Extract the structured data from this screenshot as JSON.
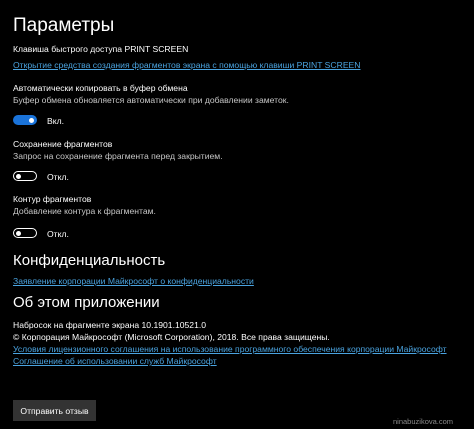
{
  "page_title": "Параметры",
  "hotkey": {
    "title": "Клавиша быстрого доступа PRINT SCREEN",
    "link": "Открытие средства создания фрагментов экрана с помощью клавиши PRINT SCREEN"
  },
  "auto_copy": {
    "title": "Автоматически копировать в буфер обмена",
    "description": "Буфер обмена обновляется автоматически при добавлении заметок.",
    "state": "Вкл.",
    "on": true
  },
  "save_snips": {
    "title": "Сохранение фрагментов",
    "description": "Запрос на сохранение фрагмента перед закрытием.",
    "state": "Откл.",
    "on": false
  },
  "outline": {
    "title": "Контур фрагментов",
    "description": "Добавление контура к фрагментам.",
    "state": "Откл.",
    "on": false
  },
  "privacy": {
    "heading": "Конфиденциальность",
    "link": "Заявление корпорации Майкрософт о конфиденциальности"
  },
  "about": {
    "heading": "Об этом приложении",
    "version": "Набросок на фрагменте экрана 10.1901.10521.0",
    "copyright": "© Корпорация Майкрософт (Microsoft Corporation), 2018. Все права защищены.",
    "license_link": "Условия лицензионного соглашения на использование программного обеспечения корпорации Майкрософт",
    "services_link": "Соглашение об использовании служб Майкрософт"
  },
  "feedback_button": "Отправить отзыв",
  "watermark": "ninabuzikova.com",
  "colors": {
    "background": "#000000",
    "accent": "#1a73d9",
    "link": "#4aa3df"
  }
}
